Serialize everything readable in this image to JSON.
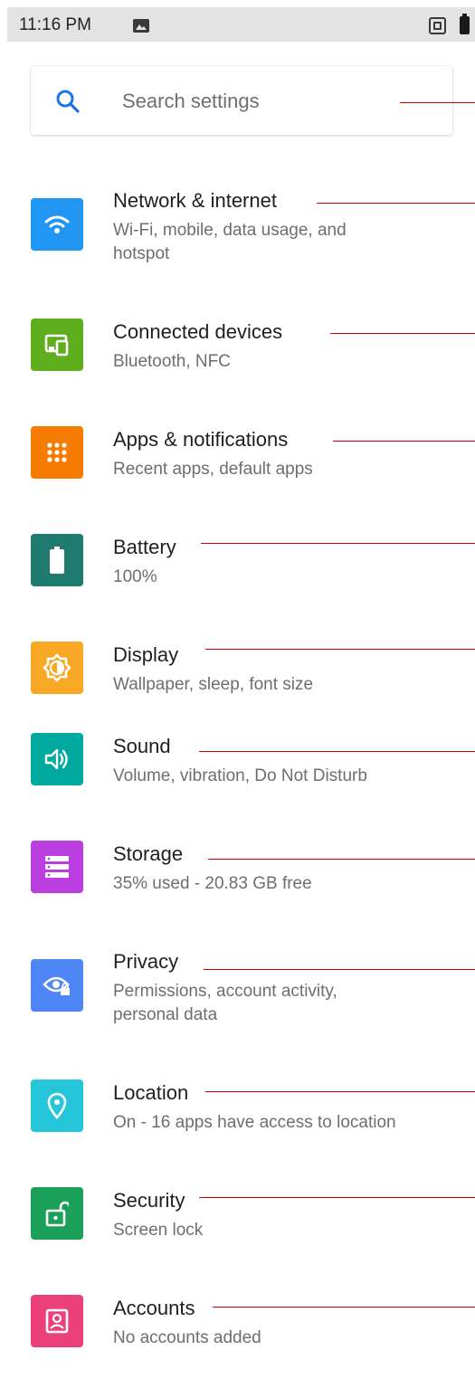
{
  "status_bar": {
    "time": "11:16 PM",
    "icons": [
      "gallery-icon",
      "nfc-icon",
      "battery-icon"
    ]
  },
  "search": {
    "placeholder": "Search settings",
    "icon": "search-icon",
    "accent": "#1a73e8"
  },
  "items": [
    {
      "title": "Network & internet",
      "summary": "Wi-Fi, mobile, data usage, and hotspot",
      "icon": "wifi-icon",
      "color": "#2196f3"
    },
    {
      "title": "Connected devices",
      "summary": "Bluetooth, NFC",
      "icon": "devices-icon",
      "color": "#5fae1e"
    },
    {
      "title": "Apps & notifications",
      "summary": "Recent apps, default apps",
      "icon": "apps-grid-icon",
      "color": "#f57c00"
    },
    {
      "title": "Battery",
      "summary": "100%",
      "icon": "battery-icon",
      "color": "#1f7a70"
    },
    {
      "title": "Display",
      "summary": "Wallpaper, sleep, font size",
      "icon": "brightness-icon",
      "color": "#f9a825"
    },
    {
      "title": "Sound",
      "summary": "Volume, vibration, Do Not Disturb",
      "icon": "volume-icon",
      "color": "#00a99d"
    },
    {
      "title": "Storage",
      "summary": "35% used - 20.83 GB free",
      "icon": "storage-icon",
      "color": "#ba3ee0"
    },
    {
      "title": "Privacy",
      "summary": "Permissions, account activity, personal data",
      "icon": "privacy-eye-icon",
      "color": "#4f86f7"
    },
    {
      "title": "Location",
      "summary": "On - 16 apps have access to location",
      "icon": "location-pin-icon",
      "color": "#26c6da"
    },
    {
      "title": "Security",
      "summary": "Screen lock",
      "icon": "lock-icon",
      "color": "#1ba05a"
    },
    {
      "title": "Accounts",
      "summary": "No accounts added",
      "icon": "account-box-icon",
      "color": "#ec407a"
    }
  ],
  "annotation_color": "#d40000"
}
